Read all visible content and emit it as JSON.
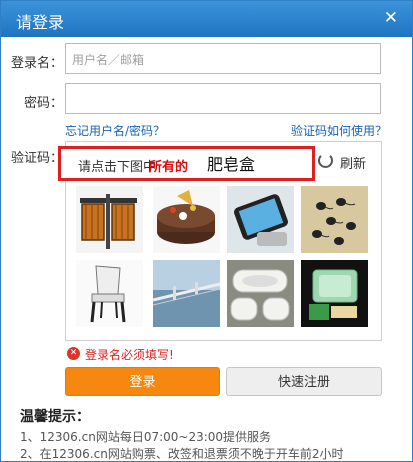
{
  "title": "请登录",
  "close_glyph": "✕",
  "form": {
    "username_label": "登录名：",
    "username_placeholder": "用户名／邮箱",
    "password_label": "密码：",
    "forgot_link": "忘记用户名/密码？",
    "captcha_help_link": "验证码如何使用？",
    "captcha_label": "验证码："
  },
  "captcha": {
    "prompt_prefix": "请点击下图中",
    "prompt_highlight": "所有的",
    "prompt_target": "肥皂盒",
    "refresh_label": "刷新",
    "tiles": [
      {
        "name": "trash-bins"
      },
      {
        "name": "cake"
      },
      {
        "name": "phone"
      },
      {
        "name": "tadpoles"
      },
      {
        "name": "chair"
      },
      {
        "name": "bridge"
      },
      {
        "name": "soap-dishes"
      },
      {
        "name": "soap-box"
      }
    ]
  },
  "error_text": "登录名必须填写!",
  "buttons": {
    "login": "登录",
    "register": "快速注册"
  },
  "tips": {
    "title": "温馨提示：",
    "items": [
      "1、12306.cn网站每日07:00~23:00提供服务",
      "2、在12306.cn网站购票、改签和退票须不晚于开车前2小时"
    ]
  },
  "colors": {
    "titlebar": "#2a82cc",
    "accent_orange": "#f6870f",
    "error_red": "#e02020",
    "link_blue": "#1a62b4"
  }
}
